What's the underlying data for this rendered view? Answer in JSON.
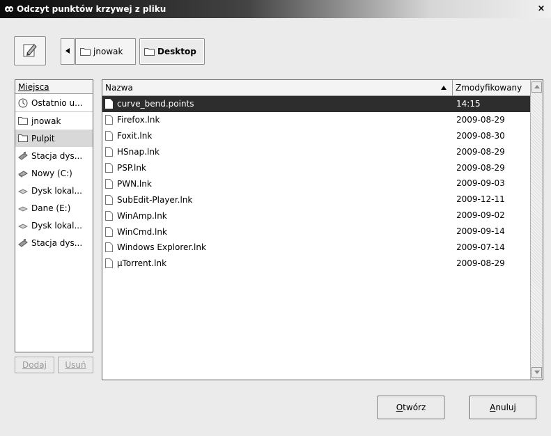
{
  "window": {
    "title": "Odczyt punktów krzywej z pliku",
    "close_glyph": "×"
  },
  "toolbar": {
    "edit_icon": "pencil-edit-icon",
    "back_icon": "triangle-left-icon",
    "crumbs": [
      {
        "label": "jnowak",
        "active": false
      },
      {
        "label": "Desktop",
        "active": true
      }
    ]
  },
  "places": {
    "header": "Miejsca",
    "items": [
      {
        "label": "Ostatnio u...",
        "icon": "recent-clock-icon"
      },
      {
        "label": "jnowak",
        "icon": "folder-icon"
      },
      {
        "label": "Pulpit",
        "icon": "folder-icon",
        "selected": true
      },
      {
        "label": "Stacja dys...",
        "icon": "floppy-drive-icon"
      },
      {
        "label": "Nowy (C:)",
        "icon": "hard-drive-icon"
      },
      {
        "label": "Dysk lokal...",
        "icon": "disk-icon"
      },
      {
        "label": "Dane (E:)",
        "icon": "disk-icon"
      },
      {
        "label": "Dysk lokal...",
        "icon": "disk-icon"
      },
      {
        "label": "Stacja dys...",
        "icon": "floppy-drive-icon"
      }
    ],
    "add_button": "Dodaj",
    "remove_button": "Usuń"
  },
  "files": {
    "columns": {
      "name": "Nazwa",
      "modified": "Zmodyfikowany"
    },
    "rows": [
      {
        "name": "curve_bend.points",
        "modified": "14:15",
        "selected": true
      },
      {
        "name": "Firefox.lnk",
        "modified": "2009-08-29"
      },
      {
        "name": "Foxit.lnk",
        "modified": "2009-08-30"
      },
      {
        "name": "HSnap.lnk",
        "modified": "2009-08-29"
      },
      {
        "name": "PSP.lnk",
        "modified": "2009-08-29"
      },
      {
        "name": "PWN.lnk",
        "modified": "2009-09-03"
      },
      {
        "name": "SubEdit-Player.lnk",
        "modified": "2009-12-11"
      },
      {
        "name": "WinAmp.lnk",
        "modified": "2009-09-02"
      },
      {
        "name": "WinCmd.lnk",
        "modified": "2009-09-14"
      },
      {
        "name": "Windows Explorer.lnk",
        "modified": "2009-07-14"
      },
      {
        "name": "µTorrent.lnk",
        "modified": "2009-08-29"
      }
    ]
  },
  "actions": {
    "open_first": "O",
    "open_rest": "twórz",
    "cancel_first": "A",
    "cancel_rest": "nuluj"
  }
}
